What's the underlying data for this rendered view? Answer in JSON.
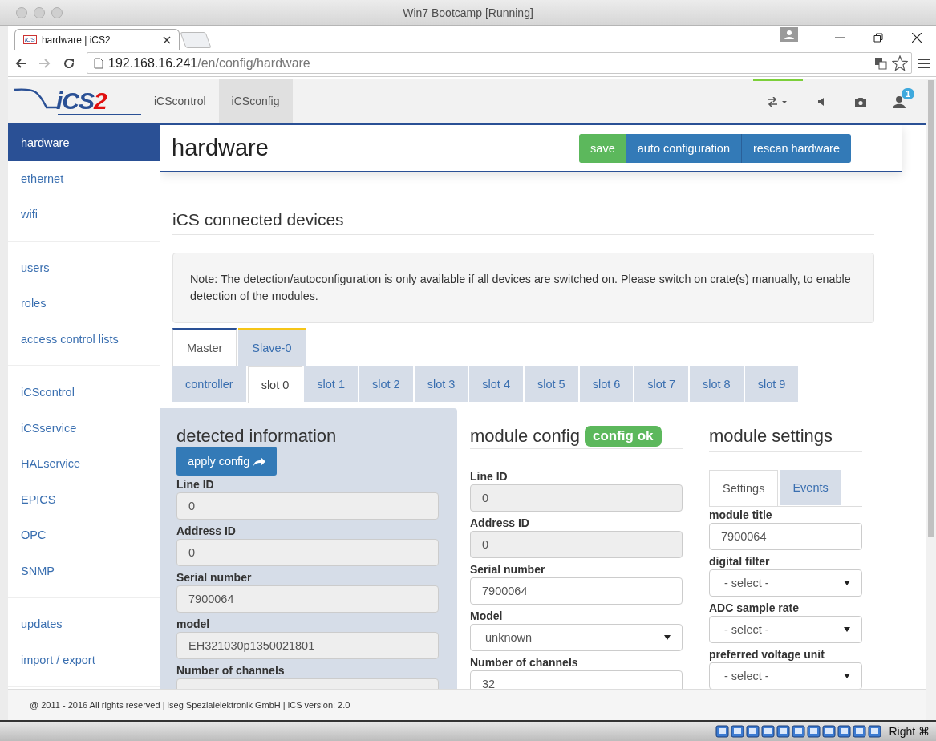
{
  "mac_window": {
    "title": "Win7 Bootcamp [Running]"
  },
  "browser": {
    "tab_title": "hardware | iCS2",
    "favicon": "iCS",
    "url_host": "192.168.16.241",
    "url_path": "/en/config/hardware"
  },
  "header": {
    "logo_main": "iCS",
    "logo_accent": "2",
    "nav": [
      {
        "label": "iCScontrol",
        "selected": false
      },
      {
        "label": "iCSconfig",
        "selected": true
      }
    ],
    "notification_count": "1"
  },
  "sidebar": {
    "groups": [
      [
        {
          "label": "hardware",
          "selected": true
        },
        {
          "label": "ethernet",
          "selected": false
        },
        {
          "label": "wifi",
          "selected": false
        }
      ],
      [
        {
          "label": "users",
          "selected": false
        },
        {
          "label": "roles",
          "selected": false
        },
        {
          "label": "access control lists",
          "selected": false
        }
      ],
      [
        {
          "label": "iCScontrol",
          "selected": false
        },
        {
          "label": "iCSservice",
          "selected": false
        },
        {
          "label": "HALservice",
          "selected": false
        },
        {
          "label": "EPICS",
          "selected": false
        },
        {
          "label": "OPC",
          "selected": false
        },
        {
          "label": "SNMP",
          "selected": false
        }
      ],
      [
        {
          "label": "updates",
          "selected": false
        },
        {
          "label": "import / export",
          "selected": false
        }
      ]
    ]
  },
  "page": {
    "title": "hardware",
    "actions": [
      {
        "label": "save",
        "kind": "success"
      },
      {
        "label": "auto configuration",
        "kind": "primary"
      },
      {
        "label": "rescan hardware",
        "kind": "primary"
      }
    ]
  },
  "section_title": "iCS connected devices",
  "note": "Note: The detection/autoconfiguration is only available if all devices are switched on. Please switch on crate(s) manually, to enable detection of the modules.",
  "device_tabs": [
    {
      "label": "Master",
      "selected": true,
      "color": "#2a5095"
    },
    {
      "label": "Slave-0",
      "selected": false,
      "color": "#f5c518"
    }
  ],
  "slot_tabs": [
    {
      "label": "controller",
      "selected": false
    },
    {
      "label": "slot 0",
      "selected": true
    },
    {
      "label": "slot 1",
      "selected": false
    },
    {
      "label": "slot 2",
      "selected": false
    },
    {
      "label": "slot 3",
      "selected": false
    },
    {
      "label": "slot 4",
      "selected": false
    },
    {
      "label": "slot 5",
      "selected": false
    },
    {
      "label": "slot 6",
      "selected": false
    },
    {
      "label": "slot 7",
      "selected": false
    },
    {
      "label": "slot 8",
      "selected": false
    },
    {
      "label": "slot 9",
      "selected": false
    }
  ],
  "detected": {
    "title": "detected information",
    "button": "apply config",
    "fields": [
      {
        "label": "Line ID",
        "value": "0",
        "kind": "readonly"
      },
      {
        "label": "Address ID",
        "value": "0",
        "kind": "readonly"
      },
      {
        "label": "Serial number",
        "value": "7900064",
        "kind": "readonly"
      },
      {
        "label": "model",
        "value": "EH321030p1350021801",
        "kind": "readonly"
      },
      {
        "label": "Number of channels",
        "kind": "readonly"
      }
    ]
  },
  "module_config": {
    "title": "module config",
    "badge": "config ok",
    "fields": [
      {
        "label": "Line ID",
        "value": "0",
        "kind": "readonly"
      },
      {
        "label": "Address ID",
        "value": "0",
        "kind": "readonly"
      },
      {
        "label": "Serial number",
        "value": "7900064",
        "kind": "input"
      },
      {
        "label": "Model",
        "value": "unknown",
        "kind": "select"
      },
      {
        "label": "Number of channels",
        "value": "32",
        "kind": "input"
      }
    ]
  },
  "module_settings": {
    "title": "module settings",
    "tabs": [
      {
        "label": "Settings",
        "selected": true
      },
      {
        "label": "Events",
        "selected": false
      }
    ],
    "fields": [
      {
        "label": "module title",
        "value": "7900064",
        "kind": "input"
      },
      {
        "label": "digital filter",
        "value": "- select -",
        "kind": "select"
      },
      {
        "label": "ADC sample rate",
        "value": "- select -",
        "kind": "select"
      },
      {
        "label": "preferred voltage unit",
        "value": "- select -",
        "kind": "select"
      }
    ]
  },
  "footer": "@ 2011 - 2016 All rights reserved | iseg Spezialelektronik GmbH | iCS version: 2.0",
  "vm_status": {
    "host_key": "Right ⌘"
  }
}
